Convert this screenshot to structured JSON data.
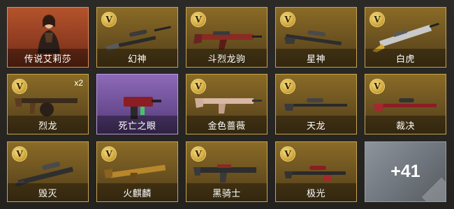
{
  "items": [
    {
      "label": "传说艾莉莎",
      "kind": "character",
      "rarity": "legendary-orange",
      "icon": "character-portrait"
    },
    {
      "label": "幻神",
      "kind": "weapon",
      "rarity": "v-gold",
      "icon": "sniper-rifle-icon"
    },
    {
      "label": "斗烈龙驹",
      "kind": "weapon",
      "rarity": "v-gold",
      "icon": "assault-rifle-icon"
    },
    {
      "label": "星神",
      "kind": "weapon",
      "rarity": "v-gold",
      "icon": "sniper-rifle-icon"
    },
    {
      "label": "白虎",
      "kind": "weapon",
      "rarity": "v-gold",
      "icon": "assault-rifle-icon"
    },
    {
      "label": "烈龙",
      "kind": "weapon",
      "rarity": "v-gold",
      "icon": "tommy-gun-icon",
      "quantity": "x2"
    },
    {
      "label": "死亡之眼",
      "kind": "weapon",
      "rarity": "epic-purple",
      "icon": "smg-icon"
    },
    {
      "label": "金色蔷薇",
      "kind": "weapon",
      "rarity": "v-gold",
      "icon": "assault-rifle-icon"
    },
    {
      "label": "天龙",
      "kind": "weapon",
      "rarity": "v-gold",
      "icon": "sniper-rifle-icon"
    },
    {
      "label": "裁决",
      "kind": "weapon",
      "rarity": "v-gold",
      "icon": "sniper-rifle-icon"
    },
    {
      "label": "毁灭",
      "kind": "weapon",
      "rarity": "v-gold",
      "icon": "heavy-sniper-icon"
    },
    {
      "label": "火麒麟",
      "kind": "weapon",
      "rarity": "v-gold",
      "icon": "assault-rifle-icon"
    },
    {
      "label": "黑骑士",
      "kind": "weapon",
      "rarity": "v-gold",
      "icon": "assault-rifle-icon"
    },
    {
      "label": "极光",
      "kind": "weapon",
      "rarity": "v-gold",
      "icon": "sniper-rifle-icon"
    }
  ],
  "more": {
    "label": "+41"
  },
  "badge_letter": "V",
  "colors": {
    "gold_border": "#c9a44a",
    "orange_card": "#b4532c",
    "purple_card": "#8d6ab8",
    "grey_card": "#8e949b"
  }
}
